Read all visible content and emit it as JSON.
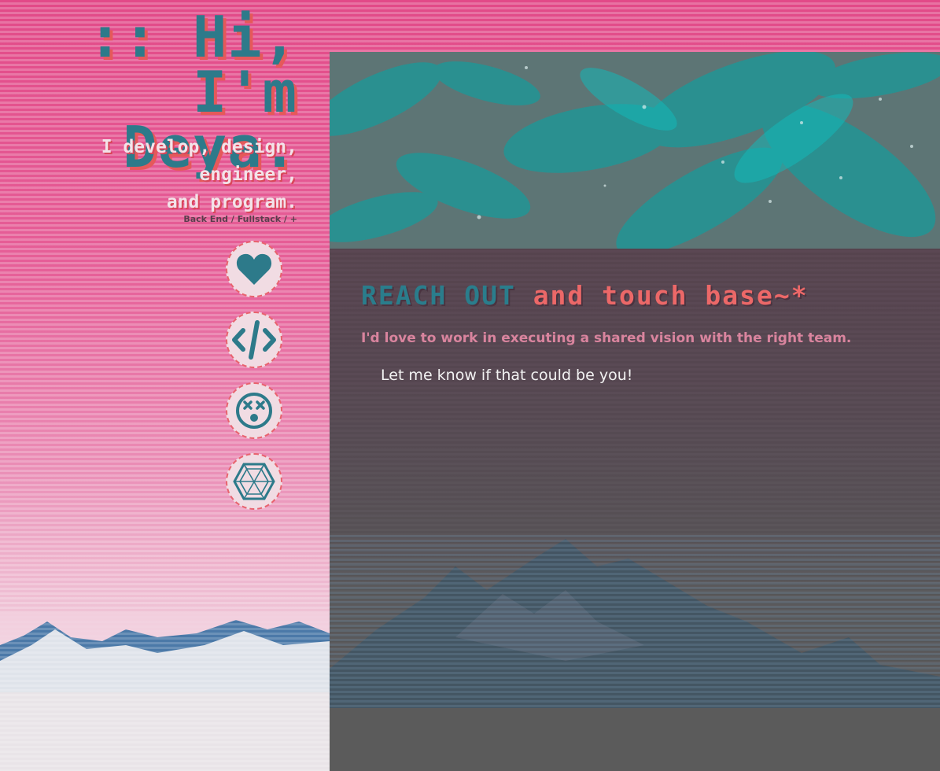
{
  "hero": {
    "title_line1": ":: Hi,",
    "title_line2": "I'm Deya.",
    "tagline_line1": "I develop, design,",
    "tagline_line2": "engineer,",
    "tagline_line3": "and program.",
    "subtag": "Back End / Fullstack / +"
  },
  "nav_icons": [
    {
      "icon": "heart-icon"
    },
    {
      "icon": "code-icon"
    },
    {
      "icon": "dizzy-face-icon"
    },
    {
      "icon": "hexagon-cube-icon"
    }
  ],
  "contact": {
    "heading_accent": "REACH OUT",
    "heading_rest": "and touch base~*",
    "subheading": "I'd love to work in executing a shared vision with the right team.",
    "body": "Let me know if that could be you!"
  },
  "colors": {
    "teal": "#2d7a8a",
    "coral": "#e5595a",
    "pink": "#e24a88",
    "panel": "#5b5b5d"
  }
}
